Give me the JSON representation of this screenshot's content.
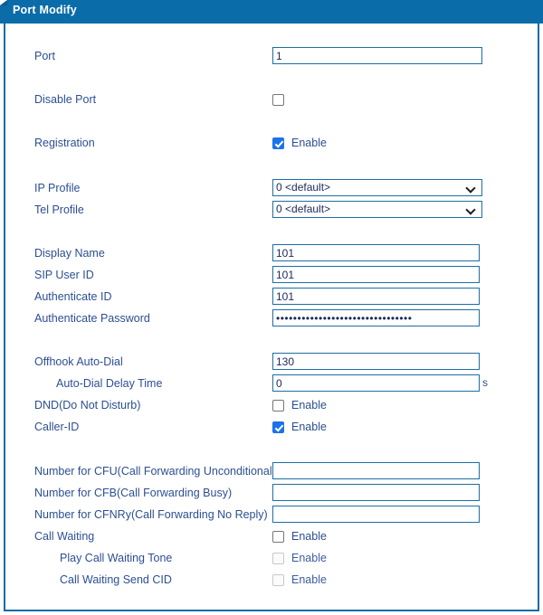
{
  "window": {
    "title": "Port Modify",
    "header_color": "#0a6ca8",
    "label_color": "#2c4f91",
    "accent_checked_color": "#1a73e8",
    "input_border_color": "#1d6ea3"
  },
  "common": {
    "enable_label": "Enable",
    "seconds_unit": "s"
  },
  "fields": {
    "port": {
      "label": "Port",
      "value": "1",
      "placeholder": ""
    },
    "disable_port": {
      "label": "Disable Port",
      "checked": false,
      "has_enable_text": false
    },
    "registration": {
      "label": "Registration",
      "checked": true,
      "enable_label": "Enable"
    },
    "ip_profile": {
      "label": "IP Profile",
      "selected": "0 <default>"
    },
    "tel_profile": {
      "label": "Tel Profile",
      "selected": "0 <default>"
    },
    "display_name": {
      "label": "Display Name",
      "value": "101",
      "placeholder": ""
    },
    "sip_user_id": {
      "label": "SIP User ID",
      "value": "101",
      "placeholder": ""
    },
    "authenticate_id": {
      "label": "Authenticate ID",
      "value": "101",
      "placeholder": ""
    },
    "authenticate_password": {
      "label": "Authenticate Password",
      "value": "••••••••••••••••••••••••••••••••",
      "placeholder": ""
    },
    "offhook_auto_dial": {
      "label": "Offhook Auto-Dial",
      "value": "130",
      "placeholder": ""
    },
    "auto_dial_delay_time": {
      "label": "Auto-Dial Delay Time",
      "value": "0",
      "unit": "s",
      "placeholder": ""
    },
    "dnd": {
      "label": "DND(Do Not Disturb)",
      "checked": false,
      "enable_label": "Enable"
    },
    "caller_id": {
      "label": "Caller-ID",
      "checked": true,
      "enable_label": "Enable"
    },
    "cfu_number": {
      "label": "Number for CFU(Call Forwarding Unconditional)",
      "value": "",
      "placeholder": ""
    },
    "cfb_number": {
      "label": "Number for CFB(Call Forwarding Busy)",
      "value": "",
      "placeholder": ""
    },
    "cfnry_number": {
      "label": "Number for CFNRy(Call Forwarding No Reply)",
      "value": "",
      "placeholder": ""
    },
    "call_waiting": {
      "label": "Call Waiting",
      "checked": false,
      "enabled": true,
      "enable_label": "Enable"
    },
    "play_call_waiting_tone": {
      "label": "Play Call Waiting Tone",
      "checked": false,
      "enabled": false,
      "enable_label": "Enable"
    },
    "call_waiting_send_cid": {
      "label": "Call Waiting Send CID",
      "checked": false,
      "enabled": false,
      "enable_label": "Enable"
    }
  }
}
